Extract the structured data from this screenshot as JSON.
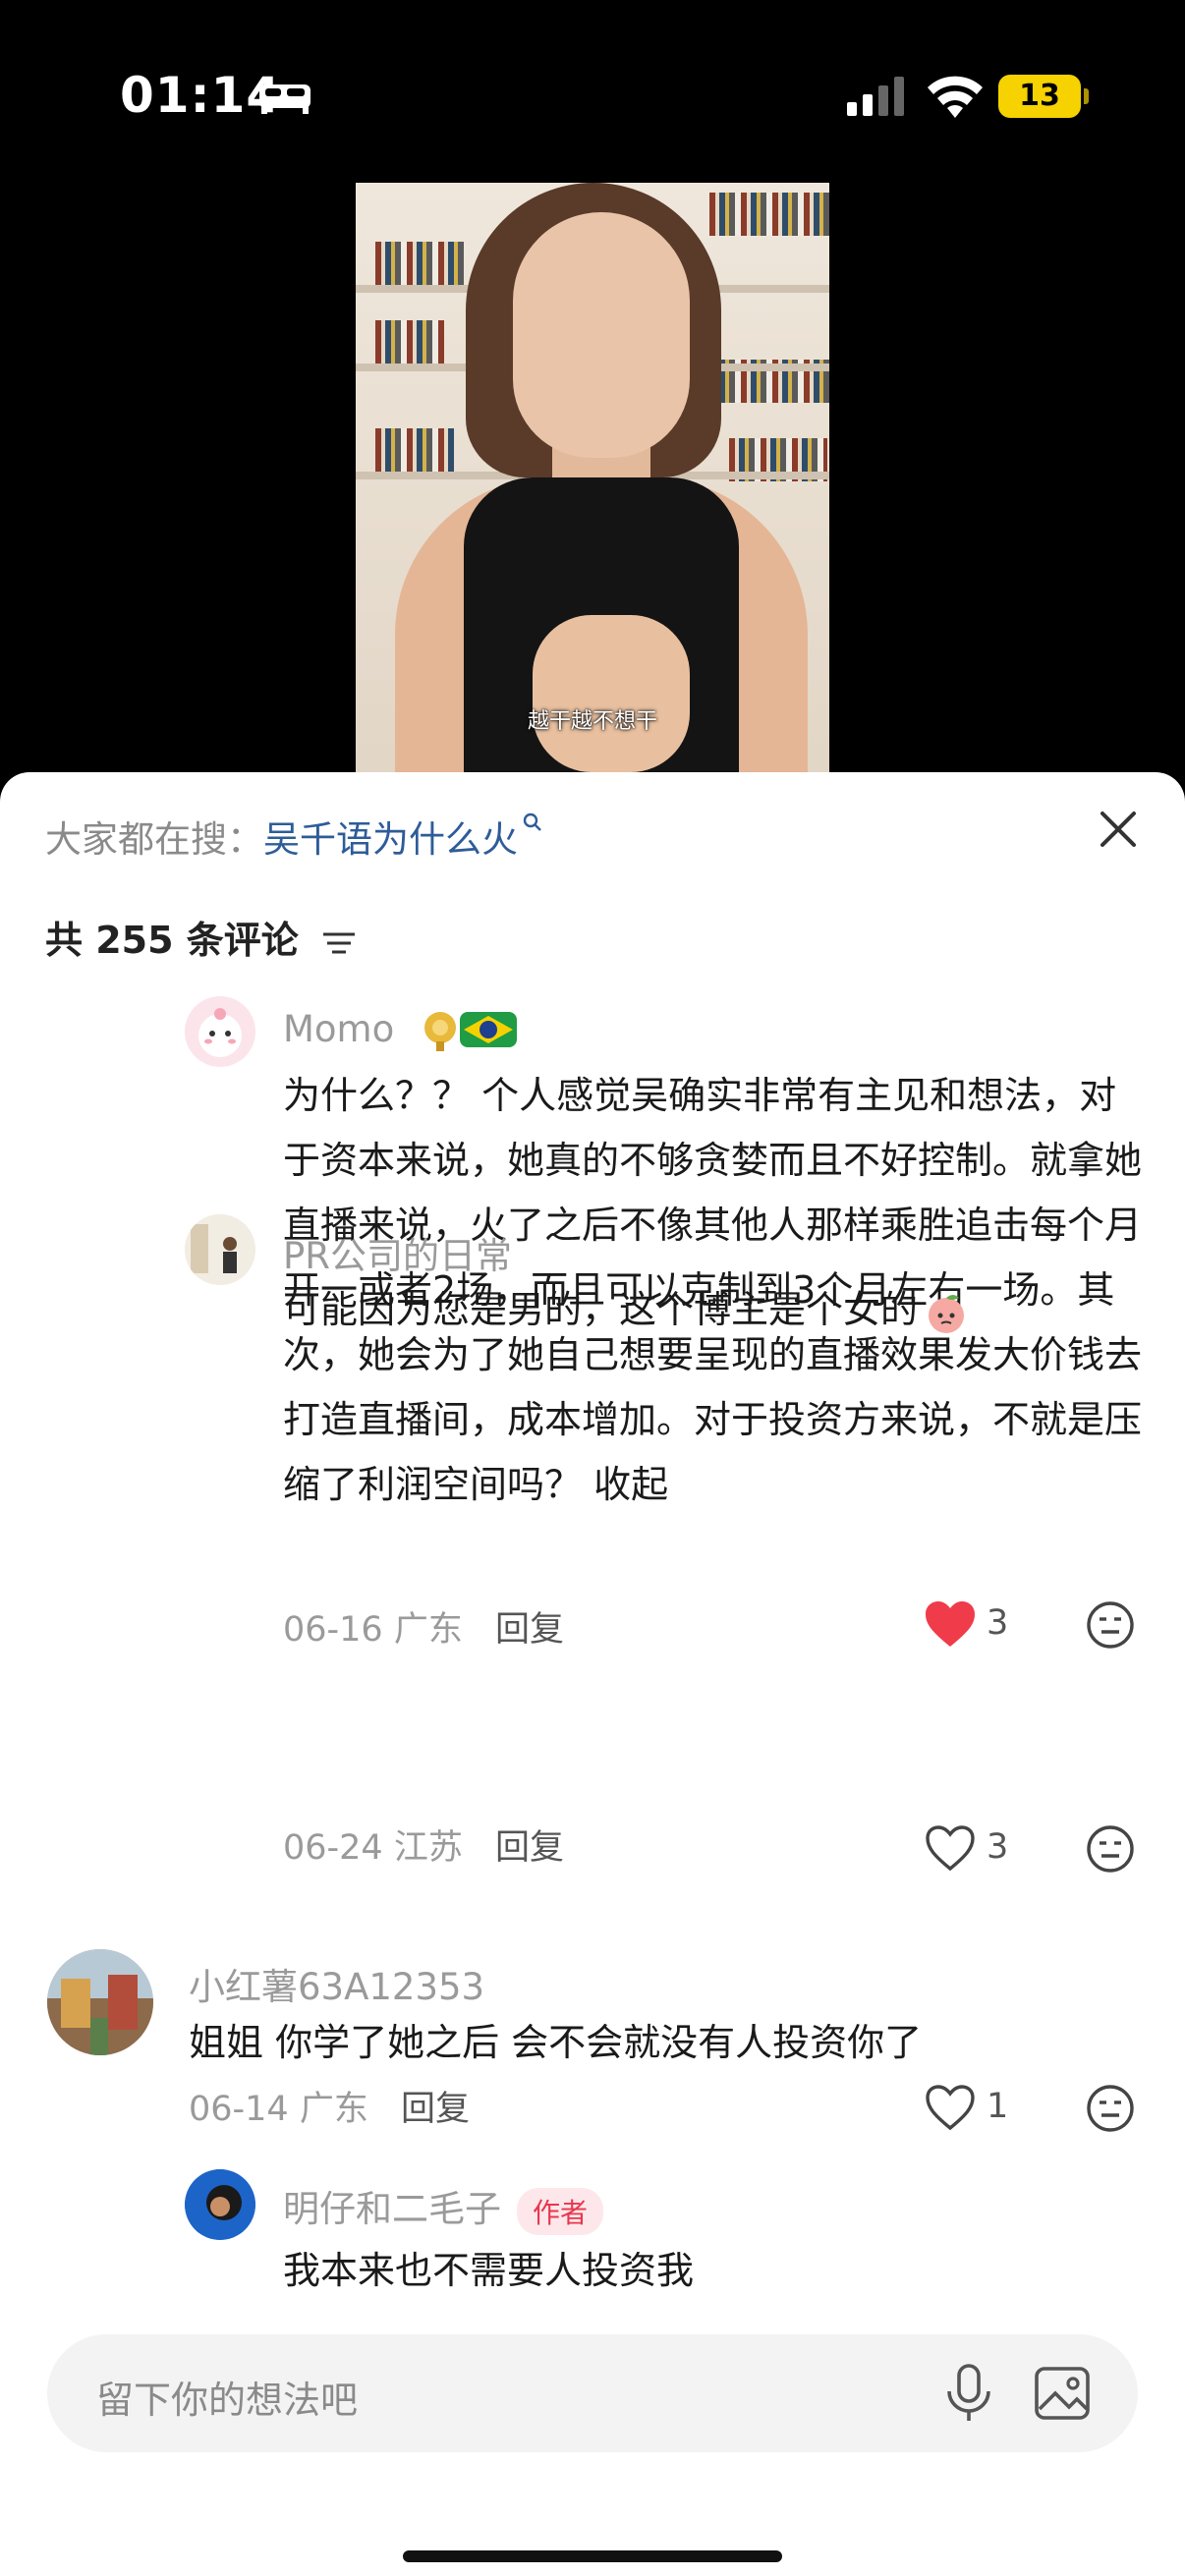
{
  "status_bar": {
    "time": "01:14",
    "battery": "13"
  },
  "video": {
    "caption": "越干越不想干"
  },
  "search": {
    "prefix": "大家都在搜：",
    "query": "吴千语为什么火"
  },
  "comments_count_label": "共 255 条评论",
  "comments": [
    {
      "username": "Momo",
      "text": "为什么？？ 个人感觉吴确实非常有主见和想法，对于资本来说，她真的不够贪婪而且不好控制。就拿她直播来说，火了之后不像其他人那样乘胜追击每个月开一或者2场，而且可以克制到3个月左右一场。其次，她会为了她自己想要呈现的直播效果发大价钱去打造直播间，成本增加。对于投资方来说，不就是压缩了利润空间吗？ 收起",
      "date": "06-16",
      "location": "广东",
      "reply": "回复",
      "likes": "3",
      "liked": true
    },
    {
      "username": "PR公司的日常",
      "text": "可能因为您是男的，这个博主是个女的",
      "date": "06-24",
      "location": "江苏",
      "reply": "回复",
      "likes": "3",
      "liked": false
    },
    {
      "username": "小红薯63A12353",
      "text": "姐姐 你学了她之后 会不会就没有人投资你了",
      "date": "06-14",
      "location": "广东",
      "reply": "回复",
      "likes": "1",
      "liked": false
    },
    {
      "username": "明仔和二毛子",
      "author_tag": "作者",
      "text": "我本来也不需要人投资我"
    }
  ],
  "input": {
    "placeholder": "留下你的想法吧"
  },
  "colors": {
    "like_red": "#f03b4a",
    "link_blue": "#2e5c99",
    "author_tag_red": "#e8374e"
  }
}
